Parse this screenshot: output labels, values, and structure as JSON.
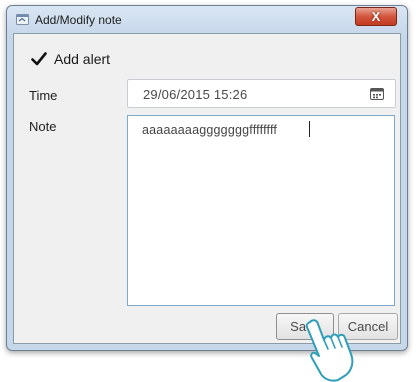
{
  "window": {
    "title": "Add/Modify note",
    "close_glyph": "X"
  },
  "form": {
    "add_alert": {
      "label": "Add alert",
      "checked": true
    },
    "time": {
      "label": "Time",
      "value": "29/06/2015 15:26"
    },
    "note": {
      "label": "Note",
      "value": "aaaaaaaagggggggffffffff"
    }
  },
  "buttons": {
    "save": "Save",
    "cancel": "Cancel"
  },
  "icons": {
    "app": "app-window-icon",
    "calendar": "calendar-icon",
    "check": "checkmark-icon",
    "cursor": "hand-pointer-icon"
  },
  "colors": {
    "title_bar": "#c6d7ea",
    "close_button": "#c23b22",
    "note_border": "#7fa9c9"
  }
}
